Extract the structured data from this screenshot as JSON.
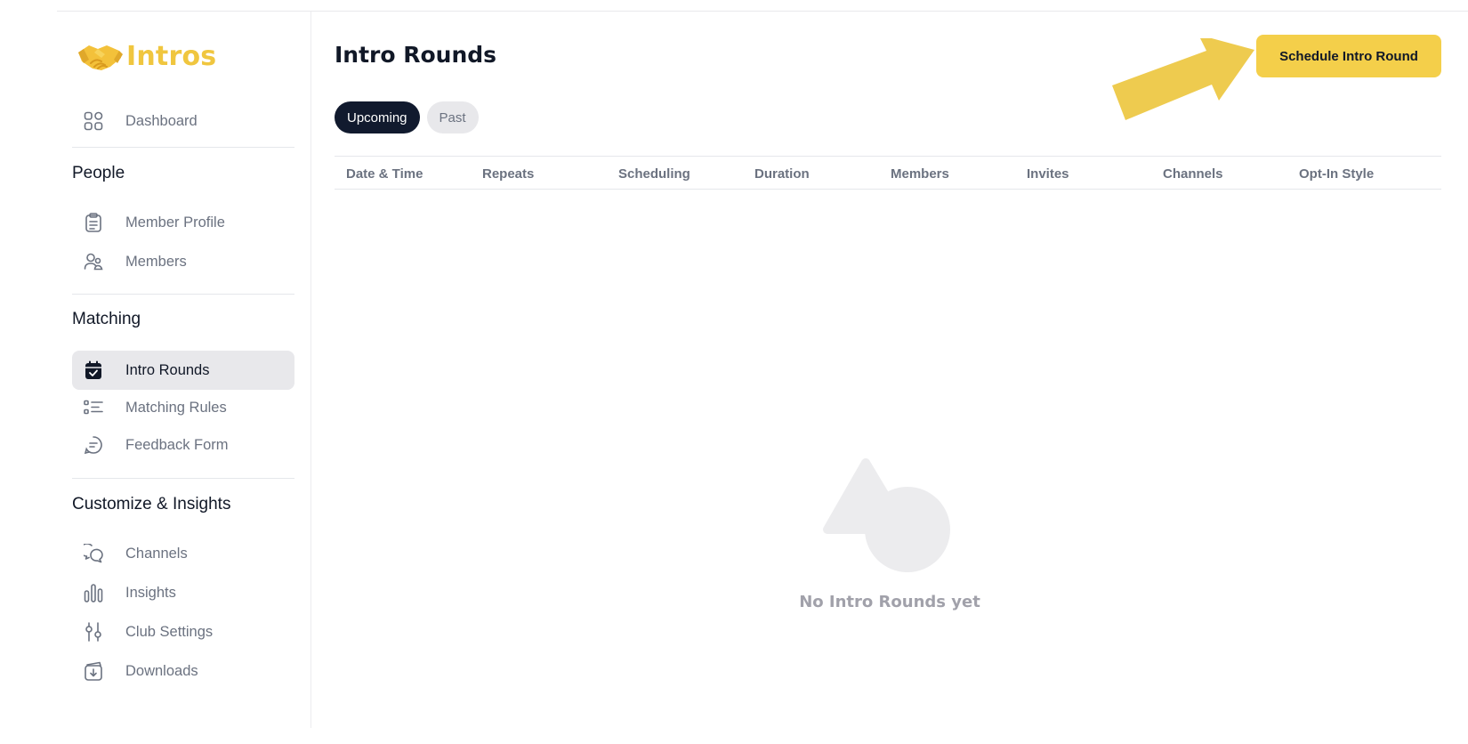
{
  "app": {
    "name": "Intros",
    "logo_icon": "handshake-icon",
    "brand_color": "#f0c63f"
  },
  "sidebar": {
    "top_items": [
      {
        "label": "Dashboard",
        "icon": "grid-icon"
      }
    ],
    "sections": [
      {
        "title": "People",
        "items": [
          {
            "label": "Member Profile",
            "icon": "clipboard-icon"
          },
          {
            "label": "Members",
            "icon": "users-icon"
          }
        ]
      },
      {
        "title": "Matching",
        "items": [
          {
            "label": "Intro Rounds",
            "icon": "calendar-check-icon",
            "active": true
          },
          {
            "label": "Matching Rules",
            "icon": "list-icon"
          },
          {
            "label": "Feedback Form",
            "icon": "message-icon"
          }
        ]
      },
      {
        "title": "Customize & Insights",
        "items": [
          {
            "label": "Channels",
            "icon": "chat-bubbles-icon"
          },
          {
            "label": "Insights",
            "icon": "bar-chart-icon"
          },
          {
            "label": "Club Settings",
            "icon": "sliders-icon"
          },
          {
            "label": "Downloads",
            "icon": "download-box-icon"
          }
        ]
      }
    ]
  },
  "main": {
    "title": "Intro Rounds",
    "cta_label": "Schedule Intro Round",
    "accent_color": "#f4cf4a",
    "tabs": [
      {
        "label": "Upcoming",
        "active": true
      },
      {
        "label": "Past",
        "active": false
      }
    ],
    "table_headers": [
      "Date & Time",
      "Repeats",
      "Scheduling",
      "Duration",
      "Members",
      "Invites",
      "Channels",
      "Opt-In Style"
    ],
    "empty_state": {
      "text": "No Intro Rounds yet",
      "icon": "shapes-icon"
    }
  }
}
